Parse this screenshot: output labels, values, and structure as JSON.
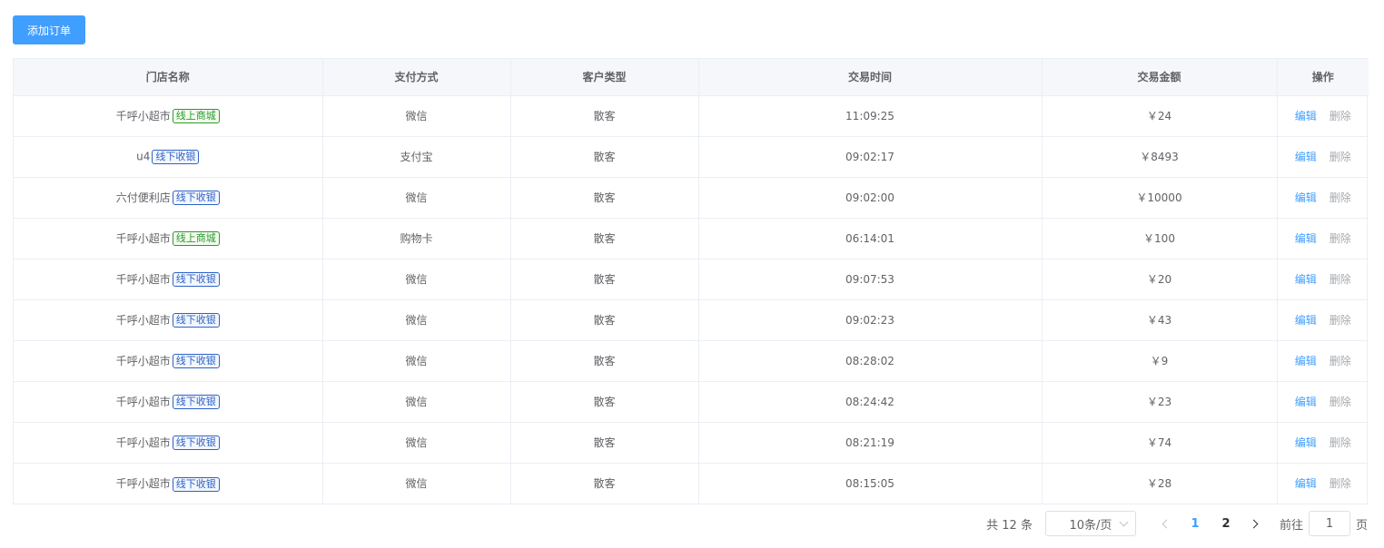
{
  "toolbar": {
    "add_label": "添加订单"
  },
  "table": {
    "columns": [
      "门店名称",
      "支付方式",
      "客户类型",
      "交易时间",
      "交易金额",
      "操作"
    ],
    "edit_label": "编辑",
    "delete_label": "删除",
    "tag_colors": {
      "线上商城": "#2c9a2c",
      "线下收银": "#2f63c6"
    },
    "rows": [
      {
        "store": "千呼小超市",
        "tag": "线上商城",
        "tag_type": "green",
        "payment": "微信",
        "customer": "散客",
        "time": "11:09:25",
        "amount": "￥24"
      },
      {
        "store": "u4",
        "tag": "线下收银",
        "tag_type": "blue",
        "payment": "支付宝",
        "customer": "散客",
        "time": "09:02:17",
        "amount": "￥8493"
      },
      {
        "store": "六付便利店",
        "tag": "线下收银",
        "tag_type": "blue",
        "payment": "微信",
        "customer": "散客",
        "time": "09:02:00",
        "amount": "￥10000"
      },
      {
        "store": "千呼小超市",
        "tag": "线上商城",
        "tag_type": "green",
        "payment": "购物卡",
        "customer": "散客",
        "time": "06:14:01",
        "amount": "￥100"
      },
      {
        "store": "千呼小超市",
        "tag": "线下收银",
        "tag_type": "blue",
        "payment": "微信",
        "customer": "散客",
        "time": "09:07:53",
        "amount": "￥20"
      },
      {
        "store": "千呼小超市",
        "tag": "线下收银",
        "tag_type": "blue",
        "payment": "微信",
        "customer": "散客",
        "time": "09:02:23",
        "amount": "￥43"
      },
      {
        "store": "千呼小超市",
        "tag": "线下收银",
        "tag_type": "blue",
        "payment": "微信",
        "customer": "散客",
        "time": "08:28:02",
        "amount": "￥9"
      },
      {
        "store": "千呼小超市",
        "tag": "线下收银",
        "tag_type": "blue",
        "payment": "微信",
        "customer": "散客",
        "time": "08:24:42",
        "amount": "￥23"
      },
      {
        "store": "千呼小超市",
        "tag": "线下收银",
        "tag_type": "blue",
        "payment": "微信",
        "customer": "散客",
        "time": "08:21:19",
        "amount": "￥74"
      },
      {
        "store": "千呼小超市",
        "tag": "线下收银",
        "tag_type": "blue",
        "payment": "微信",
        "customer": "散客",
        "time": "08:15:05",
        "amount": "￥28"
      }
    ]
  },
  "pagination": {
    "total_text": "共 12 条",
    "page_size": "10条/页",
    "pages": [
      "1",
      "2"
    ],
    "current_page": "1",
    "goto_prefix": "前往",
    "goto_value": "1",
    "goto_suffix": "页",
    "prev_icon": "chevron-left-icon",
    "next_icon": "chevron-right-icon"
  },
  "colors": {
    "primary": "#409eff",
    "header_bg": "#f5f7fa",
    "border": "#ebeef5"
  }
}
